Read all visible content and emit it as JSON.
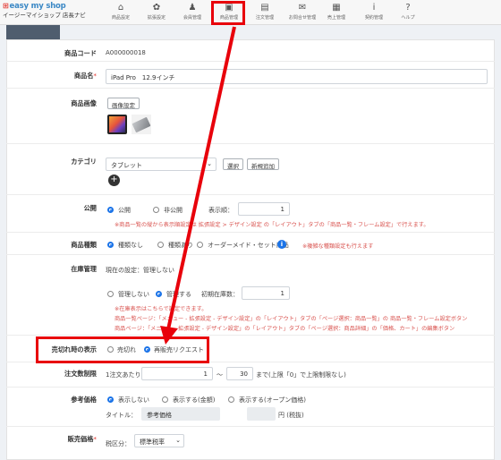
{
  "brand": {
    "name": "easy my shop",
    "subtitle": "イージーマイショップ 店長ナビ"
  },
  "nav": [
    {
      "label": "商品設定",
      "icon": "home-icon"
    },
    {
      "label": "拡張設定",
      "icon": "gear-icon"
    },
    {
      "label": "会員管理",
      "icon": "user-icon"
    },
    {
      "label": "商品管理",
      "icon": "gift-icon"
    },
    {
      "label": "注文管理",
      "icon": "document-icon"
    },
    {
      "label": "お問合せ管理",
      "icon": "mail-icon"
    },
    {
      "label": "売上管理",
      "icon": "calculator-icon"
    },
    {
      "label": "契約管理",
      "icon": "info-icon"
    },
    {
      "label": "ヘルプ",
      "icon": "question-icon"
    }
  ],
  "form": {
    "code": {
      "label": "商品コード",
      "value": "A000000018"
    },
    "name": {
      "label": "商品名",
      "required_mark": "*",
      "value": "iPad Pro　12.9インチ"
    },
    "image": {
      "label": "商品画像",
      "button": "画像設定"
    },
    "category": {
      "label": "カテゴリ",
      "selected": "タブレット",
      "select_button": "選択",
      "new_button": "新規追加"
    },
    "publish": {
      "label": "公開",
      "options": [
        "公開",
        "非公開"
      ],
      "order_label": "表示順：",
      "order_value": "1",
      "note": "※商品一覧の縦から表示順設定は 拡張設定 > デザイン設定 の「レイアウト」タブの「商品一覧・フレーム設定」で行えます。"
    },
    "type": {
      "label": "商品種類",
      "options": [
        "種類なし",
        "種類あり",
        "オーダーメイド・セット商品"
      ],
      "note": "※複雑な種類設定も行えます"
    },
    "stock": {
      "label": "在庫管理",
      "current": "現在の設定：管理しない",
      "options": [
        "管理しない",
        "管理する"
      ],
      "initial_label": "初期在庫数：",
      "initial_value": "1",
      "note1": "※在庫表示はこちらで設定できます。",
      "note2": "商品一覧ページ：「メニュー - 拡張設定 - デザイン設定」の「レイアウト」タブの「ページ選択：商品一覧」の 商品一覧・フレーム設定ボタン",
      "note3": "商品ページ：「メニュー - 拡張設定 - デザイン設定」の「レイアウト」タブの「ページ選択：商品詳細」の「価格、カート」の編集ボタン"
    },
    "soldout": {
      "label": "売切れ時の表示",
      "options": [
        "売切れ",
        "再販売リクエスト"
      ]
    },
    "limit": {
      "label": "注文数制限",
      "prefix": "1注文あたり",
      "min": "1",
      "sep": "～",
      "max": "30",
      "suffix": "まで(上限「0」で上限制限なし)"
    },
    "ref_price": {
      "label": "参考価格",
      "options": [
        "表示しない",
        "表示する(金額)",
        "表示する(オープン価格)"
      ],
      "title_label": "タイトル：",
      "title_value": "参考価格",
      "unit": "円 (税抜)"
    },
    "price": {
      "label": "販売価格",
      "required_mark": "*",
      "tax_label": "税区分：",
      "tax_value": "標準税率"
    }
  }
}
